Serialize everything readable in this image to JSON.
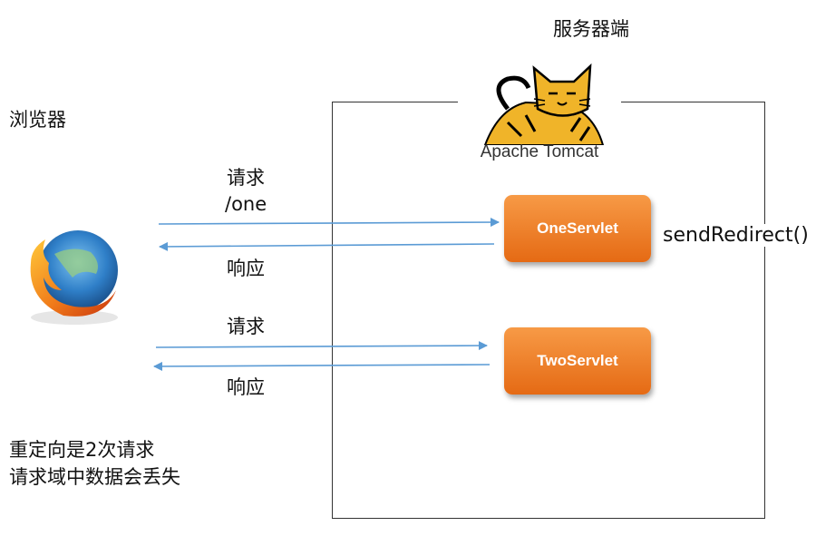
{
  "server_label": "服务器端",
  "browser_label": "浏览器",
  "tomcat_text": "Apache Tomcat",
  "request1": {
    "line1": "请求",
    "line2": "/one"
  },
  "response1": "响应",
  "request2": "请求",
  "response2": "响应",
  "servlets": {
    "one": "OneServlet",
    "two": "TwoServlet"
  },
  "redirect_call": "sendRedirect()",
  "notes": [
    "重定向是2次请求",
    "请求域中数据会丢失"
  ],
  "colors": {
    "arrow": "#5b9bd5",
    "servlet_top": "#f79a46",
    "servlet_bottom": "#e56a14",
    "box_border": "#333333"
  }
}
